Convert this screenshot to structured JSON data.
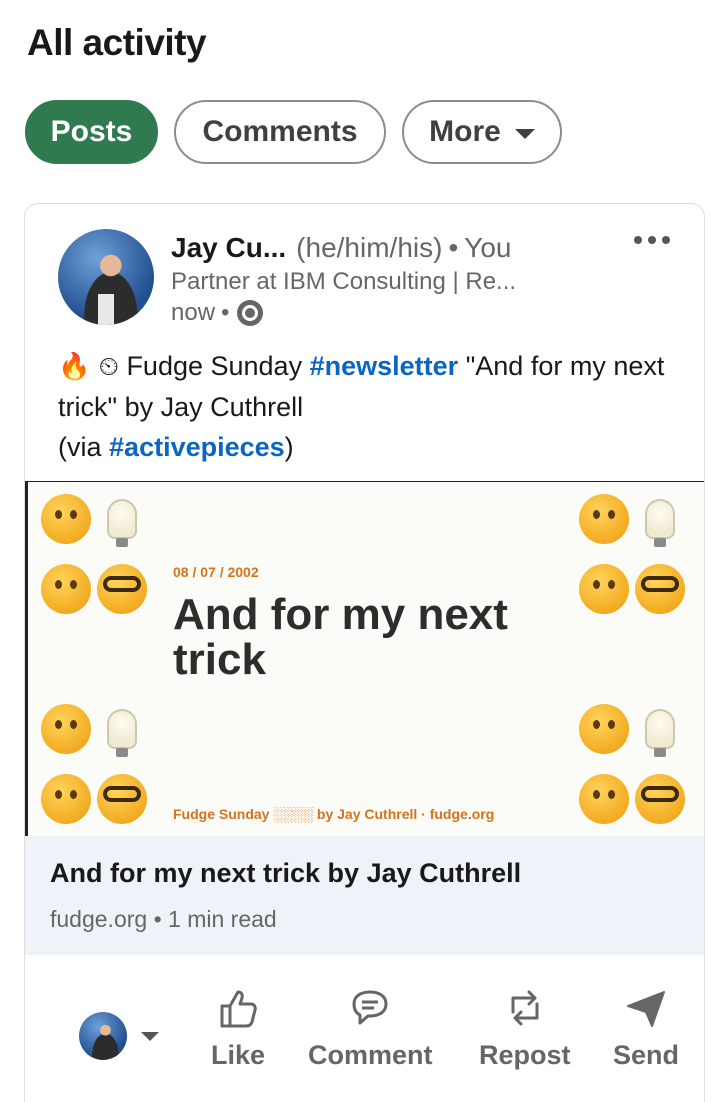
{
  "header": {
    "title": "All activity"
  },
  "filters": [
    {
      "label": "Posts",
      "active": true
    },
    {
      "label": "Comments",
      "active": false
    },
    {
      "label": "More",
      "active": false
    }
  ],
  "post": {
    "author": {
      "name": "Jay Cu...",
      "pronouns": "(he/him/his)",
      "relation": "You",
      "headline": "Partner at IBM Consulting | Re...",
      "time": "now"
    },
    "text": {
      "emoji": "🔥 ⏲",
      "lead": "Fudge Sunday",
      "hashtag1": "#newsletter",
      "quote": "\"And for my next trick\" by Jay Cuthrell",
      "via_open": "(via",
      "hashtag2": "#activepieces",
      "via_close": ")"
    },
    "preview": {
      "date": "08 / 07 / 2002",
      "title": "And for my next trick",
      "footer": "Fudge Sunday ░░░░ by Jay Cuthrell · fudge.org"
    },
    "link": {
      "title": "And for my next trick by Jay Cuthrell",
      "domain": "fudge.org",
      "read_time": "1 min read"
    },
    "actions": {
      "like": "Like",
      "comment": "Comment",
      "repost": "Repost",
      "send": "Send"
    }
  },
  "colors": {
    "active_pill": "#2f7a4f",
    "hashtag": "#0a66c2",
    "link_bg": "#edf3f8"
  }
}
